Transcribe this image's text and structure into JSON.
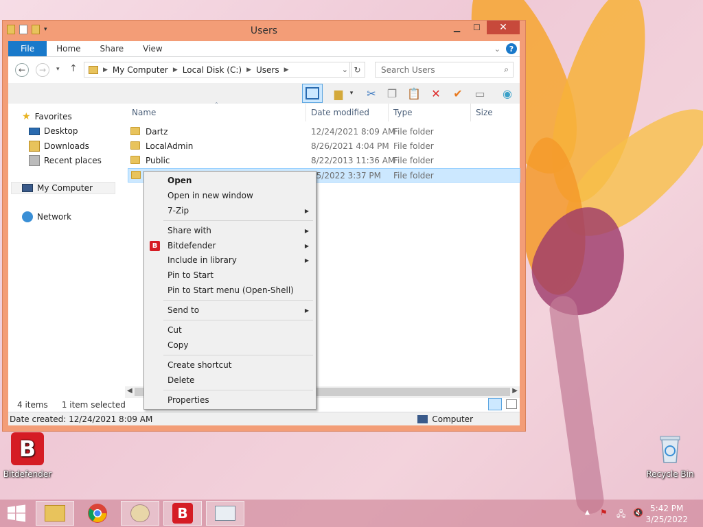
{
  "window": {
    "title": "Users",
    "ribbon_tabs": [
      "File",
      "Home",
      "Share",
      "View"
    ],
    "help": "?"
  },
  "address": {
    "crumbs": [
      "My Computer",
      "Local Disk (C:)",
      "Users"
    ],
    "search_placeholder": "Search Users"
  },
  "navpane": {
    "favorites": "Favorites",
    "desktop": "Desktop",
    "downloads": "Downloads",
    "recent": "Recent places",
    "computer": "My Computer",
    "network": "Network"
  },
  "columns": [
    "Name",
    "Date modified",
    "Type",
    "Size"
  ],
  "files": [
    {
      "name": "Dartz",
      "date": "12/24/2021 8:09 AM",
      "type": "File folder"
    },
    {
      "name": "LocalAdmin",
      "date": "8/26/2021 4:04 PM",
      "type": "File folder"
    },
    {
      "name": "Public",
      "date": "8/22/2013 11:36 AM",
      "type": "File folder"
    },
    {
      "name": "",
      "date": "25/2022 3:37 PM",
      "type": "File folder"
    }
  ],
  "status": {
    "items": "4 items",
    "selected": "1 item selected",
    "date_created": "Date created: 12/24/2021 8:09 AM",
    "computer": "Computer"
  },
  "context_menu": {
    "open": "Open",
    "open_new": "Open in new window",
    "zip": "7-Zip",
    "share": "Share with",
    "bitdefender": "Bitdefender",
    "library": "Include in library",
    "pin_start": "Pin to Start",
    "pin_openshell": "Pin to Start menu (Open-Shell)",
    "send_to": "Send to",
    "cut": "Cut",
    "copy": "Copy",
    "shortcut": "Create shortcut",
    "delete": "Delete",
    "properties": "Properties",
    "bd_badge": "B"
  },
  "desktop": {
    "bitdefender": "Bitdefender",
    "recycle": "Recycle Bin"
  },
  "taskbar": {
    "time": "5:42 PM",
    "date": "3/25/2022"
  },
  "colors": {
    "window_frame": "#f39d77",
    "accent": "#1979ca",
    "close": "#c7493b",
    "selection": "#cce8ff",
    "bitdefender": "#d51c24"
  }
}
